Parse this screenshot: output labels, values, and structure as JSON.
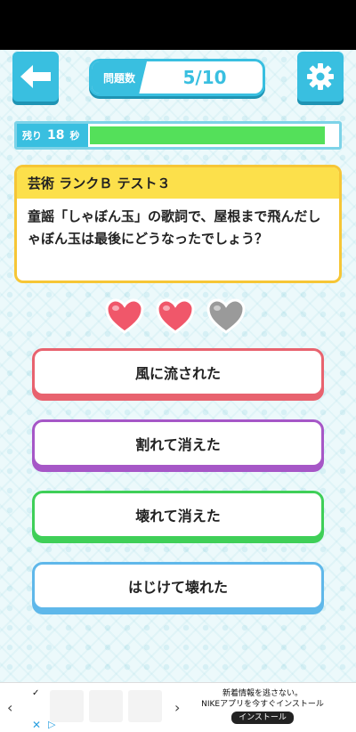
{
  "header": {
    "counter_label": "問題数",
    "counter_value": "5/10"
  },
  "timer": {
    "label_prefix": "残り",
    "seconds": "18",
    "label_suffix": "秒",
    "progress_fraction": 0.95
  },
  "question": {
    "category": "芸術 ランクＢ テスト３",
    "text": "童謡「しゃぼん玉」の歌詞で、屋根まで飛んだしゃぼん玉は最後にどうなったでしょう？"
  },
  "lives": {
    "total": 3,
    "remaining": 2,
    "active_color": "#f0576a",
    "lost_color": "#9a9a9a"
  },
  "answers": [
    {
      "label": "風に流された"
    },
    {
      "label": "割れて消えた"
    },
    {
      "label": "壊れて消えた"
    },
    {
      "label": "はじけて壊れた"
    }
  ],
  "ad": {
    "logo": "✓",
    "line1": "新着情報を逃さない。",
    "line2": "NIKEアプリを今すぐインストール",
    "cta": "インストール"
  },
  "colors": {
    "accent": "#39bfe0",
    "question_header": "#fce04b"
  }
}
